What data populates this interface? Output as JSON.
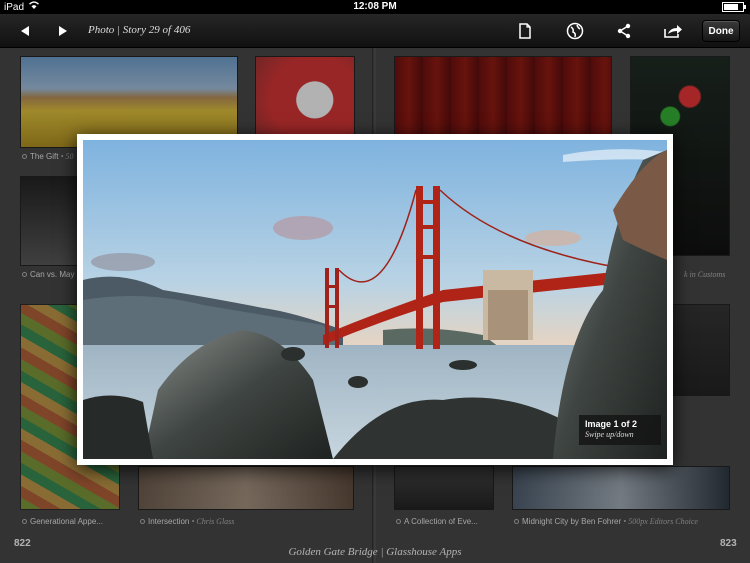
{
  "status_bar": {
    "device": "iPad",
    "time": "12:08 PM",
    "battery_level": 0.8
  },
  "toolbar": {
    "title": "Photo | Story 29 of 406",
    "back_icon": "back-arrow-icon",
    "forward_icon": "forward-arrow-icon",
    "document_icon": "document-icon",
    "globe_icon": "globe-icon",
    "share_icon": "share-icon",
    "export_icon": "export-icon",
    "done_label": "Done"
  },
  "magazine": {
    "left_page": {
      "number": "822",
      "captions": [
        {
          "title": "The Gift",
          "author": "• 50"
        },
        {
          "title": "Can vs. May",
          "author": ""
        },
        {
          "title": "Generational Appe...",
          "author": ""
        },
        {
          "title": "Intersection",
          "author": "• Chris Glass"
        }
      ]
    },
    "right_page": {
      "number": "823",
      "captions": [
        {
          "title": "A Collection of Eve...",
          "author": ""
        },
        {
          "title": "Midnight City by Ben Fohrer",
          "author": "• 500px Editors Choice"
        },
        {
          "title": "",
          "author": "k in Customs"
        }
      ]
    },
    "footer_caption": "Golden Gate Bridge | Glasshouse Apps"
  },
  "popup": {
    "counter": "Image 1 of 2",
    "hint": "Swipe up/down"
  },
  "colors": {
    "toolbar_bg": "#1a1a1a",
    "bridge_red": "#b02418",
    "sky_top": "#8fbbe0",
    "sea": "#8aa3b4"
  }
}
